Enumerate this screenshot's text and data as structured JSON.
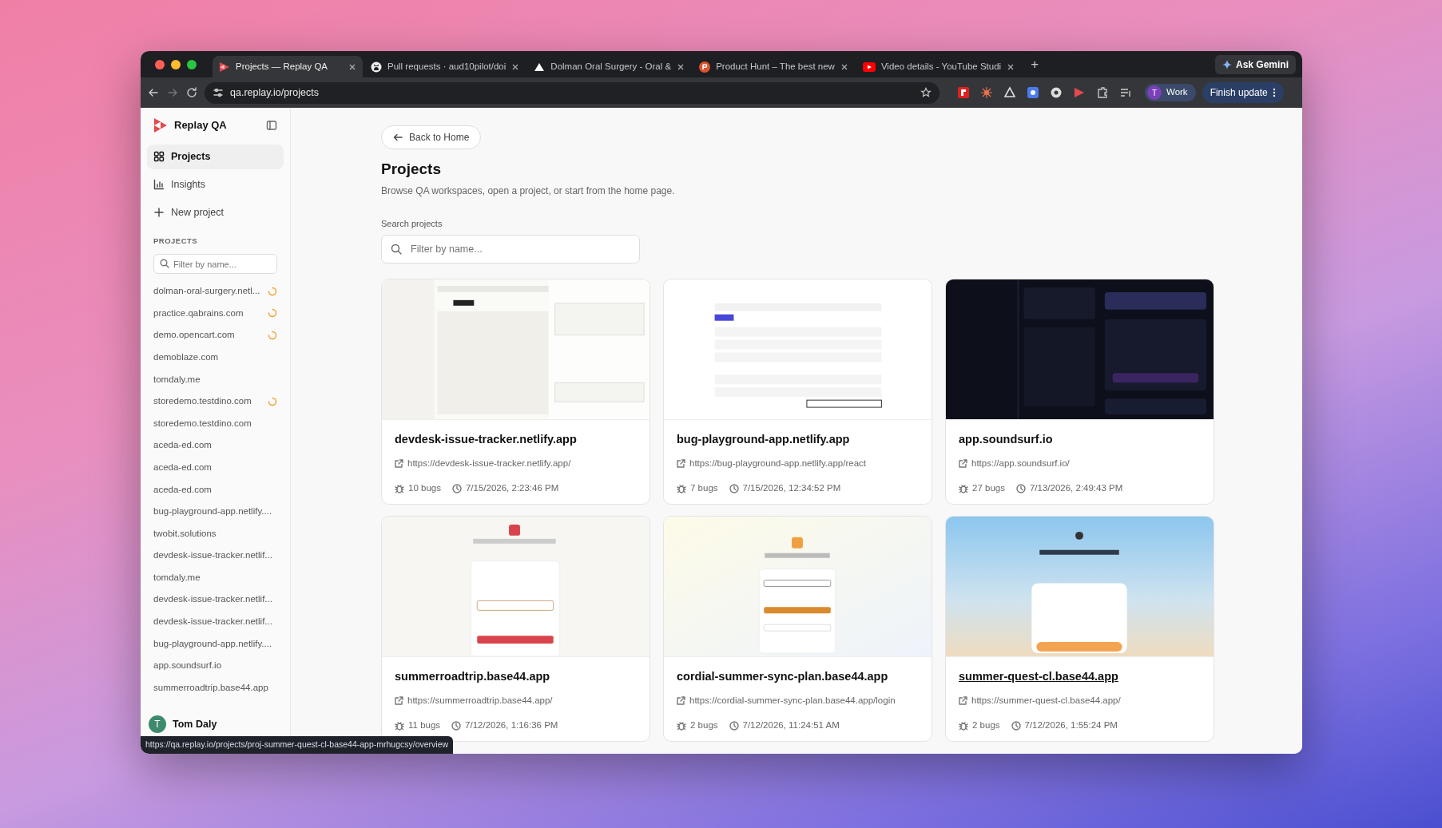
{
  "browser": {
    "tabs": [
      {
        "title": "Projects — Replay QA",
        "selected": true
      },
      {
        "title": "Pull requests · aud10pilot/doi",
        "selected": false
      },
      {
        "title": "Dolman Oral Surgery - Oral &",
        "selected": false
      },
      {
        "title": "Product Hunt – The best new",
        "selected": false
      },
      {
        "title": "Video details - YouTube Studi",
        "selected": false
      }
    ],
    "new_tab": "+",
    "gemini_button": "Ask Gemini",
    "address": "qa.replay.io/projects",
    "profile": {
      "initial": "T",
      "label": "Work"
    },
    "update_button": "Finish update"
  },
  "sidebar": {
    "brand": "Replay QA",
    "nav": [
      {
        "label": "Projects",
        "selected": true
      },
      {
        "label": "Insights",
        "selected": false
      },
      {
        "label": "New project",
        "selected": false
      }
    ],
    "section_label": "PROJECTS",
    "filter": {
      "placeholder": "Filter by name..."
    },
    "projects": [
      {
        "name": "dolman-oral-surgery.netl...",
        "syncing": true
      },
      {
        "name": "practice.qabrains.com",
        "syncing": true
      },
      {
        "name": "demo.opencart.com",
        "syncing": true
      },
      {
        "name": "demoblaze.com",
        "syncing": false
      },
      {
        "name": "tomdaly.me",
        "syncing": false
      },
      {
        "name": "storedemo.testdino.com",
        "syncing": true
      },
      {
        "name": "storedemo.testdino.com",
        "syncing": false
      },
      {
        "name": "aceda-ed.com",
        "syncing": false
      },
      {
        "name": "aceda-ed.com",
        "syncing": false
      },
      {
        "name": "aceda-ed.com",
        "syncing": false
      },
      {
        "name": "bug-playground-app.netlify....",
        "syncing": false
      },
      {
        "name": "twobit.solutions",
        "syncing": false
      },
      {
        "name": "devdesk-issue-tracker.netlif...",
        "syncing": false
      },
      {
        "name": "tomdaly.me",
        "syncing": false
      },
      {
        "name": "devdesk-issue-tracker.netlif...",
        "syncing": false
      },
      {
        "name": "devdesk-issue-tracker.netlif...",
        "syncing": false
      },
      {
        "name": "bug-playground-app.netlify....",
        "syncing": false
      },
      {
        "name": "app.soundsurf.io",
        "syncing": false
      },
      {
        "name": "summerroadtrip.base44.app",
        "syncing": false
      }
    ],
    "user": {
      "initial": "T",
      "name": "Tom Daly"
    }
  },
  "main": {
    "back_button": "Back to Home",
    "title": "Projects",
    "subtitle": "Browse QA workspaces, open a project, or start from the home page.",
    "search_label": "Search projects",
    "search": {
      "placeholder": "Filter by name..."
    },
    "cards": [
      {
        "name": "devdesk-issue-tracker.netlify.app",
        "url": "https://devdesk-issue-tracker.netlify.app/",
        "bugs": "10 bugs",
        "time": "7/15/2026, 2:23:46 PM",
        "hovered": false
      },
      {
        "name": "bug-playground-app.netlify.app",
        "url": "https://bug-playground-app.netlify.app/react",
        "bugs": "7 bugs",
        "time": "7/15/2026, 12:34:52 PM",
        "hovered": false
      },
      {
        "name": "app.soundsurf.io",
        "url": "https://app.soundsurf.io/",
        "bugs": "27 bugs",
        "time": "7/13/2026, 2:49:43 PM",
        "hovered": false
      },
      {
        "name": "summerroadtrip.base44.app",
        "url": "https://summerroadtrip.base44.app/",
        "bugs": "11 bugs",
        "time": "7/12/2026, 1:16:36 PM",
        "hovered": false
      },
      {
        "name": "cordial-summer-sync-plan.base44.app",
        "url": "https://cordial-summer-sync-plan.base44.app/login",
        "bugs": "2 bugs",
        "time": "7/12/2026, 11:24:51 AM",
        "hovered": false
      },
      {
        "name": "summer-quest-cl.base44.app",
        "url": "https://summer-quest-cl.base44.app/",
        "bugs": "2 bugs",
        "time": "7/12/2026, 1:55:24 PM",
        "hovered": true
      }
    ]
  },
  "status_url": "https://qa.replay.io/projects/proj-summer-quest-cl-base44-app-mrhugcsy/overview"
}
